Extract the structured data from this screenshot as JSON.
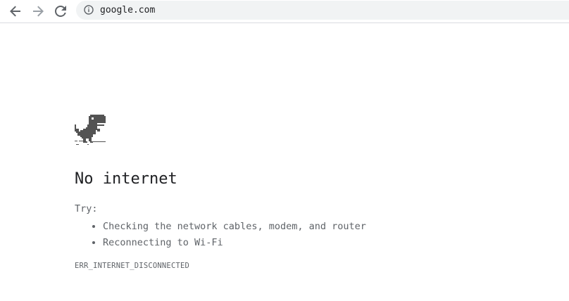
{
  "toolbar": {
    "back_icon": "arrow-left-icon",
    "forward_icon": "arrow-right-icon",
    "reload_icon": "reload-icon",
    "omnibox": {
      "info_icon": "info-circle-icon",
      "url": "google.com"
    }
  },
  "error_page": {
    "illustration": "dino-icon",
    "title": "No internet",
    "try_label": "Try:",
    "suggestions": [
      "Checking the network cables, modem, and router",
      "Reconnecting to Wi-Fi"
    ],
    "error_code": "ERR_INTERNET_DISCONNECTED"
  },
  "colors": {
    "text_primary": "#202124",
    "text_secondary": "#5f6368",
    "omnibox_bg": "#f1f3f4",
    "disabled_icon": "#9aa0a6"
  }
}
